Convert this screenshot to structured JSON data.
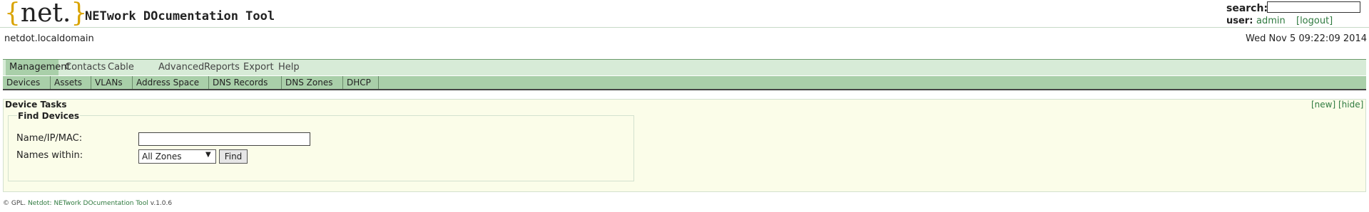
{
  "header": {
    "logo_open": "{",
    "logo_text": "net.",
    "logo_close": "}",
    "app_title": "NETwork DOcumentation Tool",
    "hostname": "netdot.localdomain",
    "datetime": "Wed Nov 5 09:22:09 2014",
    "search_label": "search:",
    "search_value": "",
    "user_label": "user:",
    "user_name": "admin",
    "logout_label": "[logout]"
  },
  "main_nav": {
    "items": [
      {
        "label": "Management",
        "active": true
      },
      {
        "label": "Contacts",
        "active": false
      },
      {
        "label": "Cable Plant",
        "active": false
      },
      {
        "label": "Advanced",
        "active": false
      },
      {
        "label": "Reports",
        "active": false
      },
      {
        "label": "Export",
        "active": false
      },
      {
        "label": "Help",
        "active": false
      }
    ]
  },
  "sub_nav": {
    "items": [
      {
        "label": "Devices"
      },
      {
        "label": "Assets"
      },
      {
        "label": "VLANs"
      },
      {
        "label": "Address Space"
      },
      {
        "label": "DNS Records"
      },
      {
        "label": "DNS Zones"
      },
      {
        "label": "DHCP"
      }
    ]
  },
  "tasks": {
    "title": "Device Tasks",
    "new_label": "[new]",
    "hide_label": "[hide]",
    "find": {
      "legend": "Find Devices",
      "name_label": "Name/IP/MAC:",
      "name_value": "",
      "zones_label": "Names within:",
      "zone_selected": "All Zones",
      "find_button": "Find"
    }
  },
  "footer": {
    "copyright": "© GPL.",
    "product_link": "Netdot: NETwork DOcumentation Tool",
    "version": "v.1.0.6"
  },
  "colors": {
    "accent_link": "#2f7a3f",
    "nav_bg": "#d7ebd7",
    "nav_active": "#a9cfa9",
    "panel_bg": "#fbfde9",
    "logo_brace": "#d9a300"
  }
}
